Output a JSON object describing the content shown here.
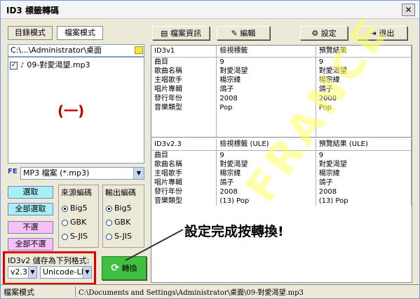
{
  "window": {
    "title": "ID3 標籤轉碼",
    "close": "✕"
  },
  "left": {
    "tabs": [
      "目錄模式",
      "檔案模式"
    ],
    "path": "C:\\...\\Administrator\\桌面",
    "files": [
      {
        "name": "09-對愛渴望.mp3",
        "checked": true
      }
    ],
    "annotation": "(一)",
    "filter_icon": "FE",
    "filter": "MP3 檔案 (*.mp3)"
  },
  "toolbar": {
    "info": "檔案資訊",
    "edit": "編輯",
    "settings": "設定",
    "exit": "退出"
  },
  "id3v1": {
    "headers": [
      "ID3v1",
      "檢視標籤",
      "預覽結果"
    ],
    "rows": [
      [
        "曲目",
        "9",
        "9"
      ],
      [
        "歌曲名稱",
        "對愛渴望",
        "對愛渴望"
      ],
      [
        "主唱歌手",
        "楊宗緯",
        "楊宗緯"
      ],
      [
        "唱片專輯",
        "鴿子",
        "鴿子"
      ],
      [
        "發行年份",
        "2008",
        "2008"
      ],
      [
        "音樂類型",
        "Pop",
        "Pop"
      ]
    ]
  },
  "id3v2": {
    "headers": [
      "ID3v2.3",
      "檢視標籤 (ULE)",
      "預覽結果 (ULE)"
    ],
    "rows": [
      [
        "曲目",
        "9",
        "9"
      ],
      [
        "歌曲名稱",
        "對愛渴望",
        "對愛渴望"
      ],
      [
        "主唱歌手",
        "楊宗緯",
        "楊宗緯"
      ],
      [
        "唱片專輯",
        "鴿子",
        "鴿子"
      ],
      [
        "發行年份",
        "2008",
        "2008"
      ],
      [
        "音樂類型",
        "(13) Pop",
        "(13) Pop"
      ]
    ]
  },
  "select_buttons": {
    "select": "選取",
    "select_all": "全部選取",
    "deselect": "不選",
    "deselect_all": "全部不選"
  },
  "source_encoding": {
    "label": "來源編碼",
    "options": [
      "Big5",
      "GBK",
      "S-JIS"
    ],
    "selected": "Big5"
  },
  "output_encoding": {
    "label": "輸出編碼",
    "options": [
      "Big5",
      "GBK",
      "S-JIS"
    ],
    "selected": "Big5"
  },
  "save_format": {
    "label": "ID3v2 儲存為下列格式:",
    "version": "v2.3",
    "encoding": "Unicode-LE"
  },
  "convert_button": "轉換",
  "callout": "設定完成按轉換!",
  "status": {
    "mode": "檔案模式",
    "path": "C:\\Documents and Settings\\Administrator\\桌面\\09-對愛渴望.mp3"
  },
  "watermark": "FRANCE",
  "colors": {
    "highlight_red": "#e00000",
    "select_cyan": "#a8f0f8",
    "deselect_pink": "#f8c0f8",
    "callout_text": "#000000",
    "watermark": "#ffff66"
  }
}
